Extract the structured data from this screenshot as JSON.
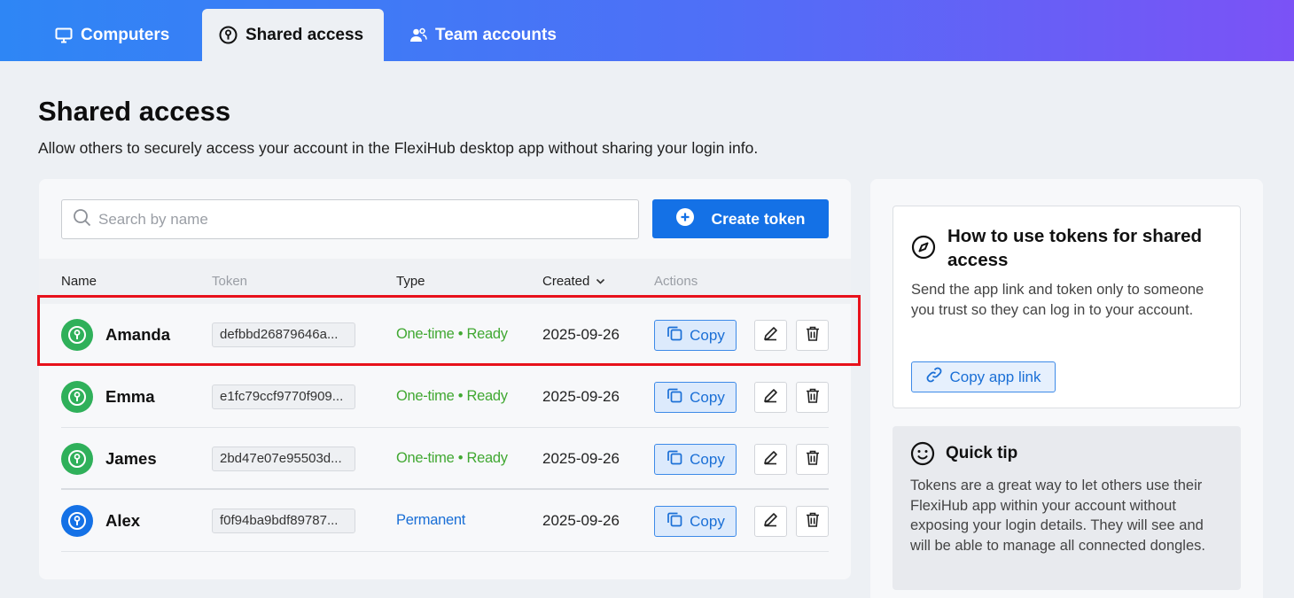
{
  "nav": {
    "tabs": [
      {
        "label": "Computers",
        "icon": "monitor-icon",
        "active": false
      },
      {
        "label": "Shared access",
        "icon": "key-circle-icon",
        "active": true
      },
      {
        "label": "Team accounts",
        "icon": "users-icon",
        "active": false
      }
    ]
  },
  "page": {
    "title": "Shared access",
    "subtitle": "Allow others to securely access your account in the FlexiHub desktop app without sharing your login info."
  },
  "toolbar": {
    "search_placeholder": "Search by name",
    "create_label": "Create token"
  },
  "table": {
    "columns": {
      "name": "Name",
      "token": "Token",
      "type": "Type",
      "created": "Created",
      "actions": "Actions"
    },
    "rows": [
      {
        "name": "Amanda",
        "token": "defbbd26879646a...",
        "type": "One-time • Ready",
        "type_color": "#41a832",
        "created": "2025-09-26",
        "copy": "Copy",
        "icon_color": "#2fb05a",
        "highlighted": true
      },
      {
        "name": "Emma",
        "token": "e1fc79ccf9770f909...",
        "type": "One-time • Ready",
        "type_color": "#41a832",
        "created": "2025-09-26",
        "copy": "Copy",
        "icon_color": "#2fb05a"
      },
      {
        "name": "James",
        "token": "2bd47e07e95503d...",
        "type": "One-time • Ready",
        "type_color": "#41a832",
        "created": "2025-09-26",
        "copy": "Copy",
        "icon_color": "#2fb05a"
      },
      {
        "name": "Alex",
        "token": "f0f94ba9bdf89787...",
        "type": "Permanent",
        "type_color": "#1a6fd6",
        "created": "2025-09-26",
        "copy": "Copy",
        "icon_color": "#1471e6"
      }
    ]
  },
  "howto": {
    "title": "How to use tokens for shared access",
    "text": "Send the app link and token only to someone you trust so they can log in to your account.",
    "button": "Copy app link"
  },
  "tip": {
    "title": "Quick tip",
    "text": "Tokens are a great way to let others use their FlexiHub app within your account without exposing your login details. They will see and will be able to manage all connected dongles."
  },
  "colors": {
    "accent": "#1471e6",
    "highlight": "#e8111b",
    "gradient_start": "#2e86f5",
    "gradient_end": "#7b52f6"
  }
}
